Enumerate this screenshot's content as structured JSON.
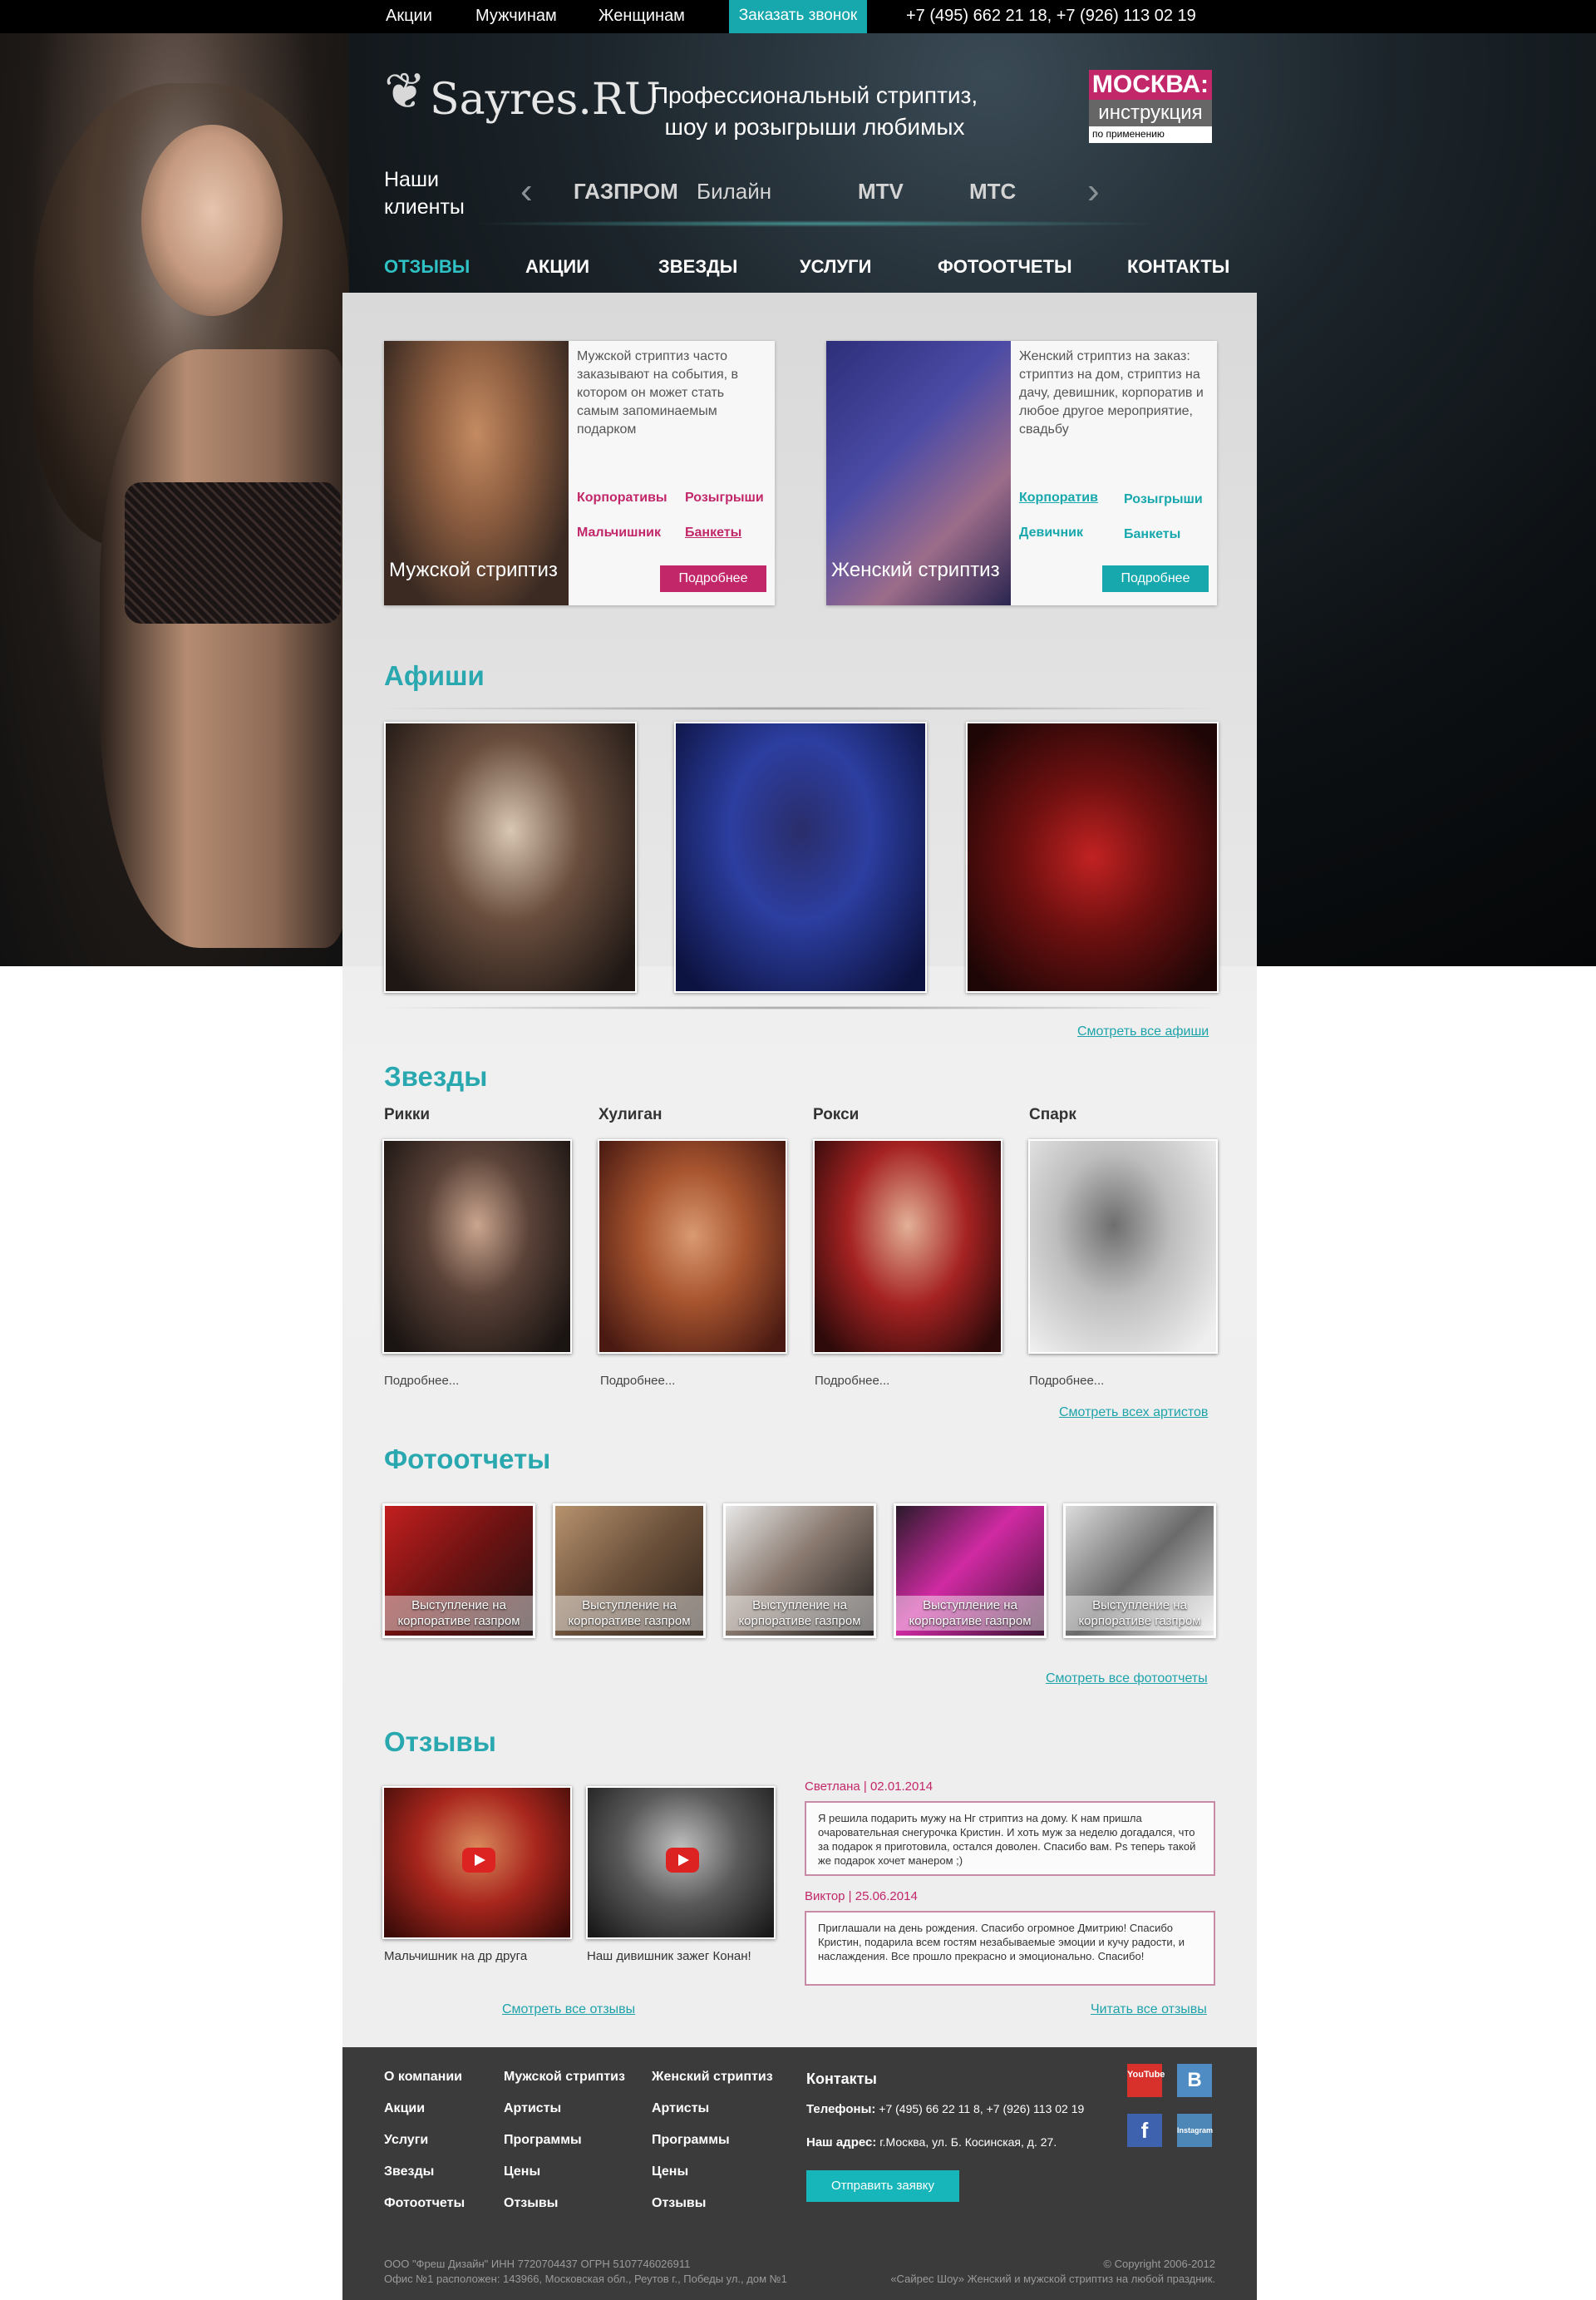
{
  "topbar": {
    "links": [
      "Акции",
      "Мужчинам",
      "Женщинам"
    ],
    "call_button": "Заказать звонок",
    "phones": "+7 (495) 662 21 18, +7 (926) 113 02 19"
  },
  "header": {
    "logo_text": "Sayres.RU",
    "tagline_1": "Профессиональный стриптиз,",
    "tagline_2": "шоу и розыгрыши любимых",
    "moscow_badge": {
      "line1": "МОСКВА:",
      "line2": "инструкция",
      "line3": "по применению"
    },
    "clients_title_1": "Наши",
    "clients_title_2": "клиенты",
    "clients": [
      "ГАЗПРОМ",
      "Билайн",
      "MTV",
      "МТС"
    ]
  },
  "nav": {
    "items": [
      "ОТЗЫВЫ",
      "АКЦИИ",
      "ЗВЕЗДЫ",
      "УСЛУГИ",
      "ФОТООТЧЕТЫ",
      "КОНТАКТЫ"
    ],
    "active_index": 0
  },
  "promos": [
    {
      "caption": "Мужской стриптиз",
      "description": "Мужской стриптиз часто заказывают на события, в котором он может стать самым запоминаемым подарком",
      "tags": [
        "Корпоративы",
        "Розыгрыши",
        "Мальчишник",
        "Банкеты"
      ],
      "more": "Подробнее",
      "accent": "#c2276a"
    },
    {
      "caption": "Женский стриптиз",
      "description": "Женский стриптиз на заказ: стриптиз на дом, стриптиз на дачу, девишник, корпоратив и любое другое мероприятие, свадьбу",
      "tags": [
        "Корпоратив",
        "Розыгрыши",
        "Девичник",
        "Банкеты"
      ],
      "more": "Подробнее",
      "accent": "#17a8ad"
    }
  ],
  "afishi": {
    "title": "Афиши",
    "see_all": "Смотреть все афиши"
  },
  "stars": {
    "title": "Звезды",
    "items": [
      {
        "name": "Рикки",
        "more": "Подробнее..."
      },
      {
        "name": "Хулиган",
        "more": "Подробнее..."
      },
      {
        "name": "Рокси",
        "more": "Подробнее..."
      },
      {
        "name": "Спарк",
        "more": "Подробнее..."
      }
    ],
    "see_all": "Смотреть всех артистов"
  },
  "reports": {
    "title": "Фотоотчеты",
    "items": [
      "Выступление на корпоративе газпром",
      "Выступление на корпоративе газпром",
      "Выступление на корпоративе газпром",
      "Выступление на корпоративе газпром",
      "Выступление на корпоративе газпром"
    ],
    "see_all": "Смотреть все фотоотчеты"
  },
  "reviews": {
    "title": "Отзывы",
    "videos": [
      "Мальчишник на др друга",
      "Наш дивишник зажег Конан!"
    ],
    "texts": [
      {
        "head": "Светлана | 02.01.2014",
        "body": "Я решила подарить мужу на Нг стриптиз на дому. К нам пришла очаровательная снегурочка Кристин. И хоть муж за неделю догадался, что за подарок я приготовила, остался доволен. Спасибо вам. Ps теперь такой же подарок хочет манером ;)"
      },
      {
        "head": "Виктор | 25.06.2014",
        "body": "Приглашали на день рождения. Спасибо огромное Дмитрию! Спасибо Кристин, подарила всем гостям незабываемые эмоции и кучу радости, и наслаждения. Все прошло прекрасно и эмоционально. Спасибо!"
      }
    ],
    "see_all_videos": "Смотреть все отзывы",
    "read_all": "Читать все отзывы"
  },
  "footer": {
    "col1": [
      "О компании",
      "Акции",
      "Услуги",
      "Звезды",
      "Фотоотчеты"
    ],
    "col2": [
      "Мужской стриптиз",
      "Артисты",
      "Программы",
      "Цены",
      "Отзывы"
    ],
    "col3": [
      "Женский стриптиз",
      "Артисты",
      "Программы",
      "Цены",
      "Отзывы"
    ],
    "contacts_title": "Контакты",
    "phones_label": "Телефоны:",
    "phones": "+7 (495) 66 22 11 8, +7 (926) 113 02 19",
    "address_label": "Наш адрес:",
    "address": "г.Москва, ул. Б. Косинская, д. 27.",
    "send_button": "Отправить заявку",
    "social": [
      "YouTube",
      "В",
      "f",
      "Instagram"
    ],
    "legal_1": "ООО \"Фреш Дизайн\" ИНН 7720704437 ОГРН 5107746026911",
    "legal_2": "Офис №1 расположен: 143966, Московская обл., Реутов г., Победы ул., дом №1",
    "copyright": "© Copyright 2006-2012",
    "slogan": "«Сайрес Шоу» Женский и мужской стриптиз на любой праздник."
  }
}
